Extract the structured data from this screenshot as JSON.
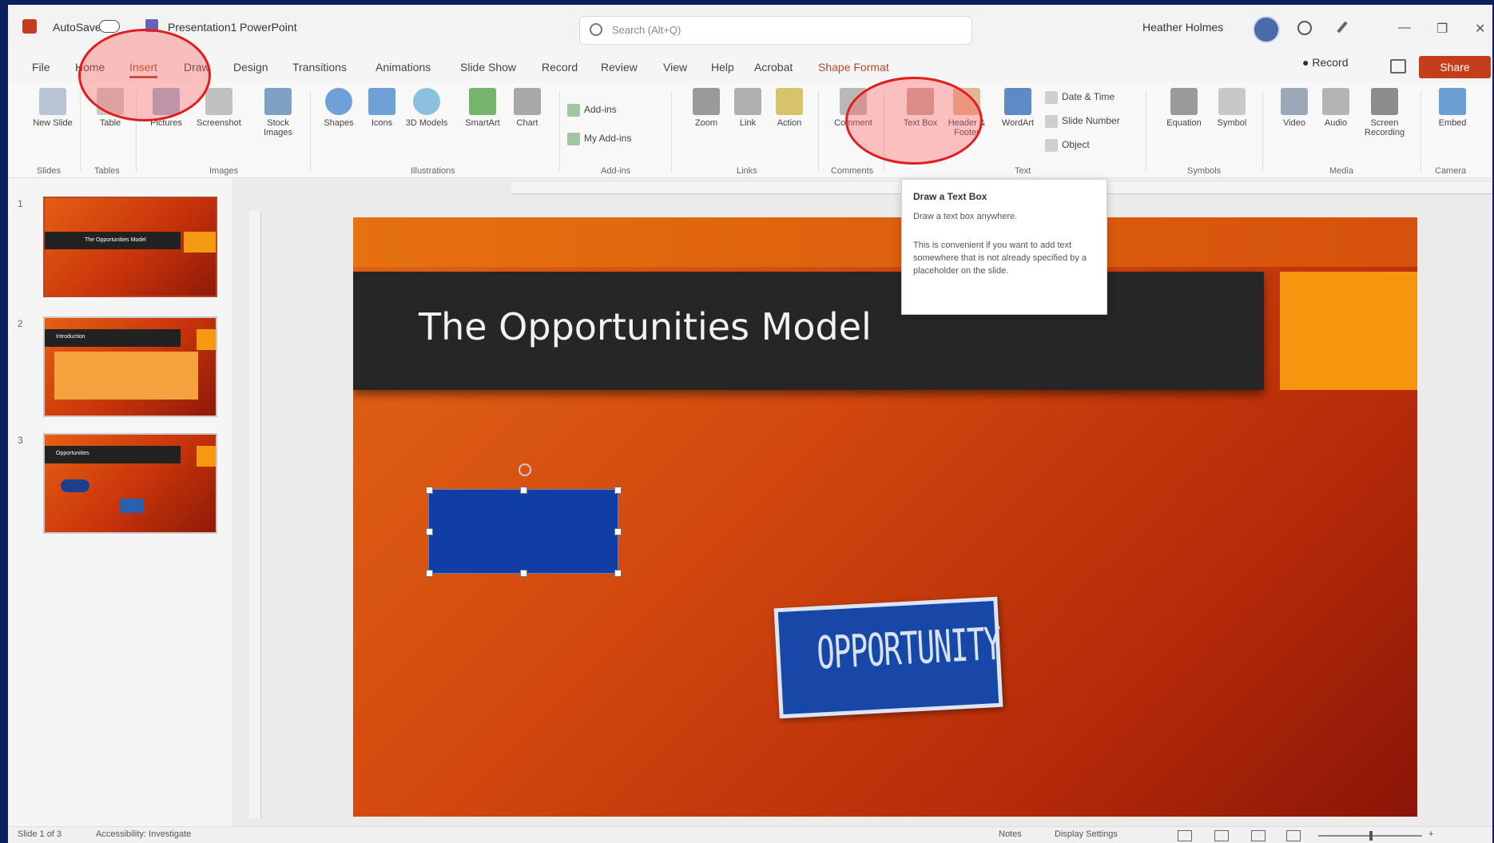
{
  "titlebar": {
    "autosave": "AutoSave",
    "document": "Presentation1",
    "app": "PowerPoint",
    "search_placeholder": "Search (Alt+Q)",
    "user": "Heather Holmes",
    "minimize": "—",
    "restore": "❐",
    "close": "✕"
  },
  "tabs": [
    "File",
    "Home",
    "Insert",
    "Draw",
    "Design",
    "Transitions",
    "Animations",
    "Slide Show",
    "Record",
    "Review",
    "View",
    "Help",
    "Acrobat",
    "Shape Format"
  ],
  "record_label": "● Record",
  "share_label": "Share",
  "ribbon": {
    "buttons": [
      {
        "label": "New Slide",
        "color": "#b9c4d4"
      },
      {
        "label": "Table",
        "color": "#c9c9c9"
      },
      {
        "label": "Pictures",
        "color": "#9cb6cf"
      },
      {
        "label": "Screenshot",
        "color": "#c0c0c0"
      },
      {
        "label": "Stock Images",
        "color": "#7fa2c4"
      },
      {
        "label": "Shapes",
        "color": "#6fa0d8"
      },
      {
        "label": "Icons",
        "color": "#6fa0d8"
      },
      {
        "label": "3D Models",
        "color": "#8cc0e0"
      },
      {
        "label": "SmartArt",
        "color": "#76b56e"
      },
      {
        "label": "Chart",
        "color": "#a8a8a8"
      },
      {
        "label": "Zoom",
        "color": "#9a9a9a"
      },
      {
        "label": "Link",
        "color": "#b0b0b0"
      },
      {
        "label": "Action",
        "color": "#d6c46a"
      },
      {
        "label": "Comment",
        "color": "#b8b8b8"
      },
      {
        "label": "Text Box",
        "color": "#c9a8a0"
      },
      {
        "label": "Header & Footer",
        "color": "#e2b796"
      },
      {
        "label": "WordArt",
        "color": "#5e8bc6"
      },
      {
        "label": "Equation",
        "color": "#9a9a9a"
      },
      {
        "label": "Symbol",
        "color": "#c8c8c8"
      },
      {
        "label": "Video",
        "color": "#9aa8b8"
      },
      {
        "label": "Audio",
        "color": "#b4b4b4"
      },
      {
        "label": "Screen Recording",
        "color": "#8d8d8d"
      },
      {
        "label": "Embed",
        "color": "#6c9fd4"
      }
    ],
    "small_buttons": [
      "Add-ins",
      "My Add-ins",
      "Date & Time",
      "Slide Number",
      "Object"
    ],
    "groups": [
      "Slides",
      "Tables",
      "Images",
      "Illustrations",
      "Add-ins",
      "Links",
      "Comments",
      "Text",
      "Symbols",
      "Media",
      "Camera"
    ]
  },
  "thumbnails": [
    {
      "num": "1",
      "text": "The Opportunities Model"
    },
    {
      "num": "2",
      "text": "Introduction"
    },
    {
      "num": "3",
      "text": "Opportunities"
    }
  ],
  "slide": {
    "title": "The Opportunities Model",
    "stamp_text": "OPPORTUNITY"
  },
  "tooltip": {
    "title": "Draw a Text Box",
    "subtitle": "Draw a text box anywhere.",
    "body": "This is convenient if you want to add text somewhere that is not already specified by a placeholder on the slide."
  },
  "status": {
    "slide_info": "Slide 1 of 3",
    "accessibility": "Accessibility: Investigate",
    "notes": "Notes",
    "display": "Display Settings",
    "zoom": "+"
  }
}
